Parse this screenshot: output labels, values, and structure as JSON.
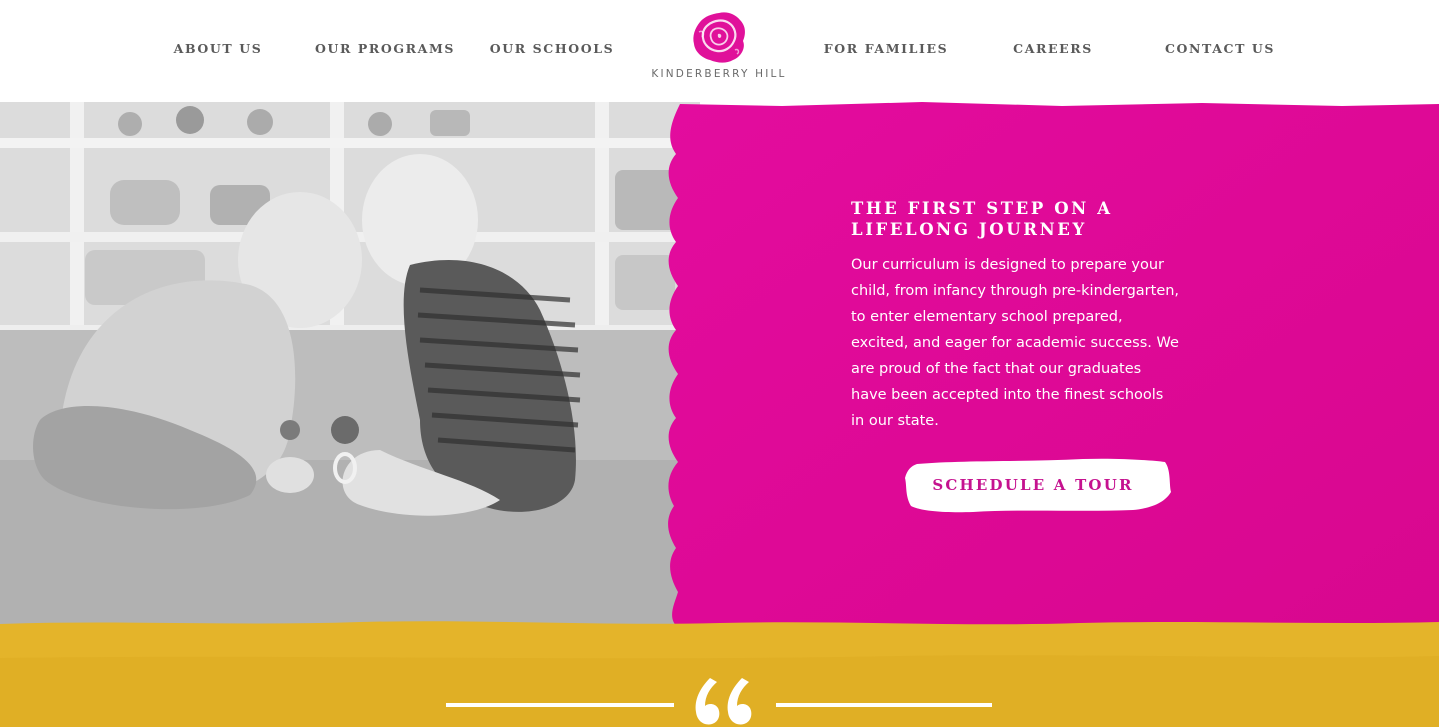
{
  "nav": {
    "items": [
      {
        "label": "ABOUT US"
      },
      {
        "label": "OUR PROGRAMS"
      },
      {
        "label": "OUR SCHOOLS"
      },
      {
        "label": "FOR FAMILIES"
      },
      {
        "label": "CAREERS"
      },
      {
        "label": "CONTACT US"
      }
    ]
  },
  "logo": {
    "text": "KINDERBERRY HILL",
    "icon": "berry-logo-icon"
  },
  "hero": {
    "photo_icon": "babies-playing-photo",
    "heading": "THE FIRST STEP ON A LIFELONG JOURNEY",
    "body": "Our curriculum is designed to prepare your child, from infancy through pre-kindergarten, to enter elementary school prepared, excited, and eager for academic success. We are proud of the fact that our graduates have been accepted into the finest schools in our state.",
    "cta_label": "SCHEDULE A TOUR"
  },
  "testimonial": {
    "icon": "quote-icon"
  },
  "colors": {
    "brand_magenta": "#e0119a",
    "cta_text": "#c5128f",
    "band_yellow": "#e4b42a",
    "nav_text": "#5a5a5a"
  }
}
